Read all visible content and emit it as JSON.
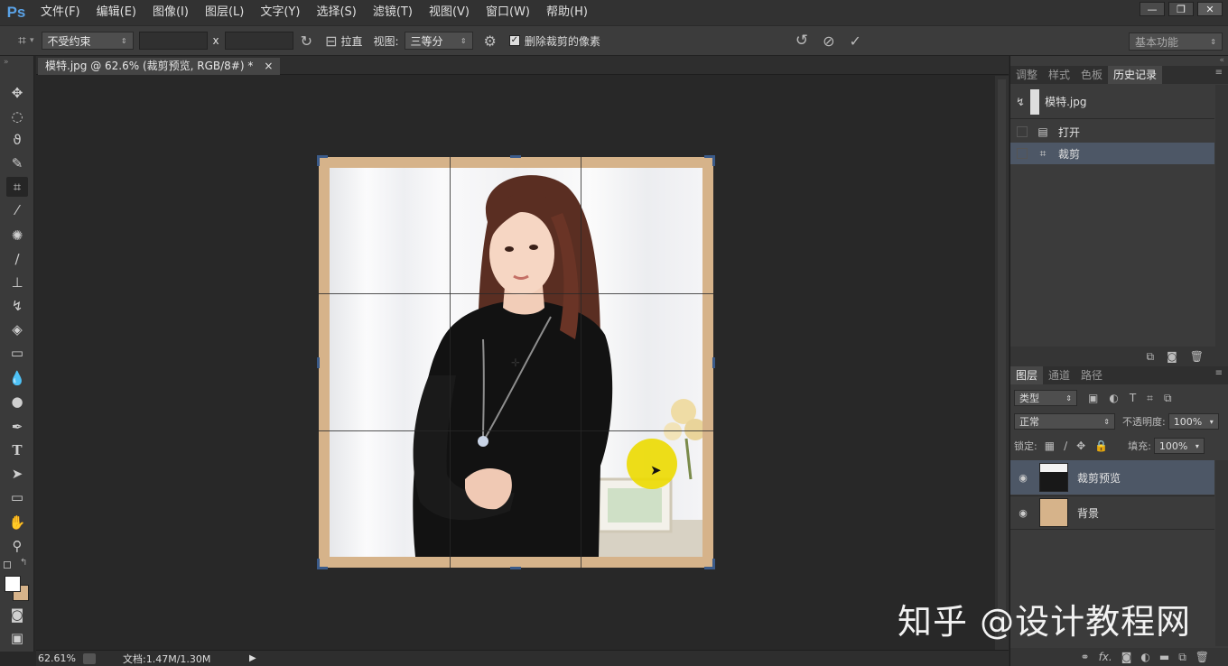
{
  "app": {
    "logo": "Ps"
  },
  "menu": [
    "文件(F)",
    "编辑(E)",
    "图像(I)",
    "图层(L)",
    "文字(Y)",
    "选择(S)",
    "滤镜(T)",
    "视图(V)",
    "窗口(W)",
    "帮助(H)"
  ],
  "window_controls": {
    "minimize": "—",
    "restore": "❐",
    "close": "✕"
  },
  "options": {
    "ratio_value": "不受约束",
    "separator": "x",
    "straighten_label": "拉直",
    "view_label": "视图:",
    "view_value": "三等分",
    "delete_pixels_label": "删除裁剪的像素",
    "workspace_value": "基本功能"
  },
  "document": {
    "tab_title": "模特.jpg @ 62.6% (裁剪预览, RGB/8#) *",
    "tab_close": "×"
  },
  "status": {
    "zoom": "62.61%",
    "doc_info": "文档:1.47M/1.30M"
  },
  "history_panel": {
    "tabs": [
      "调整",
      "样式",
      "色板",
      "历史记录"
    ],
    "active_tab": 3,
    "snapshot": "模特.jpg",
    "items": [
      "打开",
      "裁剪"
    ],
    "selected_item": 1
  },
  "layers_panel": {
    "tabs": [
      "图层",
      "通道",
      "路径"
    ],
    "filter_value": "类型",
    "blend_mode": "正常",
    "opacity_label": "不透明度:",
    "opacity_value": "100%",
    "lock_label": "锁定:",
    "fill_label": "填充:",
    "fill_value": "100%",
    "layers": [
      {
        "name": "裁剪预览",
        "selected": true
      },
      {
        "name": "背景",
        "selected": false
      }
    ],
    "footer_fx": "fx."
  },
  "watermark": "知乎 @设计教程网",
  "colors": {
    "accent_blue": "#5aa2e6",
    "selection": "#4d5766",
    "photo_border": "#d6b38a",
    "cursor_highlight": "#ecda00"
  }
}
